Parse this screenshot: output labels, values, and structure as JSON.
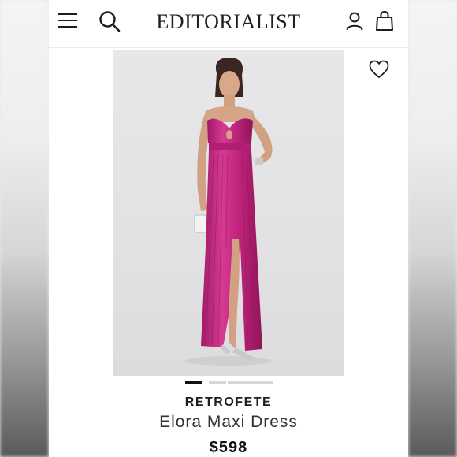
{
  "header": {
    "logo_text": "EDITORIALIST"
  },
  "product": {
    "brand": "RETROFETE",
    "name": "Elora Maxi Dress",
    "price": "$598",
    "image_count": 5,
    "active_image": 1
  },
  "icons": {
    "menu": "hamburger-menu-icon",
    "search": "search-icon",
    "account": "account-icon",
    "bag": "shopping-bag-icon",
    "wishlist": "heart-icon"
  },
  "colors": {
    "dress": "#c2247d",
    "text": "#1e1e1e",
    "image_bg": "#e3e3e5"
  }
}
